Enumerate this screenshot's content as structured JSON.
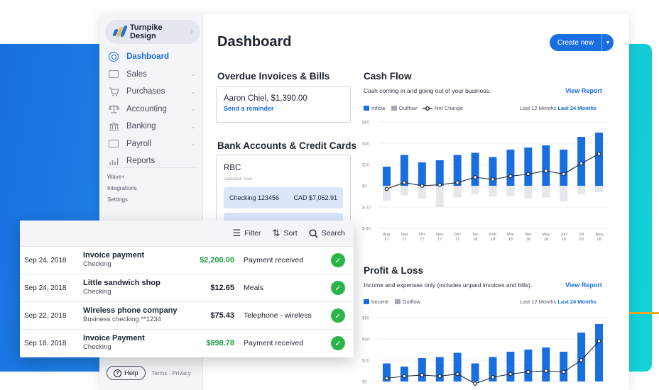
{
  "sidebar": {
    "business_name": "Turnpike Design",
    "nav": [
      {
        "label": "Dashboard",
        "icon": "dashboard-icon",
        "active": true,
        "expandable": false
      },
      {
        "label": "Sales",
        "icon": "sales-icon",
        "active": false,
        "expandable": true
      },
      {
        "label": "Purchases",
        "icon": "cart-icon",
        "active": false,
        "expandable": true
      },
      {
        "label": "Accounting",
        "icon": "scale-icon",
        "active": false,
        "expandable": true
      },
      {
        "label": "Banking",
        "icon": "bank-icon",
        "active": false,
        "expandable": true
      },
      {
        "label": "Payroll",
        "icon": "payroll-icon",
        "active": false,
        "expandable": true
      },
      {
        "label": "Reports",
        "icon": "reports-icon",
        "active": false,
        "expandable": false
      }
    ],
    "links": [
      "Wave+",
      "Integrations",
      "Settings"
    ],
    "help_label": "Help",
    "terms_label": "Terms · Privacy"
  },
  "header": {
    "title": "Dashboard",
    "create_label": "Create new"
  },
  "overdue": {
    "title": "Overdue Invoices & Bills",
    "item": "Aaron Chiel, $1,390.00",
    "reminder": "Send a reminder"
  },
  "bank": {
    "title": "Bank Accounts & Credit Cards",
    "name": "RBC",
    "updated": "Updated: now",
    "account_name": "Checking 123456",
    "account_balance": "CAD $7,062.91"
  },
  "cashflow": {
    "title": "Cash Flow",
    "description": "Cash coming in and going out of your business.",
    "view_report": "View Report",
    "legend": [
      "Inflow",
      "Outflow",
      "Net Change"
    ],
    "range_inactive": "Last 12 Months",
    "range_active": "Last 24 Months"
  },
  "pnl": {
    "title": "Profit & Loss",
    "description": "Income and expenses only (includes unpaid invoices and bills).",
    "view_report": "View Report",
    "legend": [
      "Income",
      "Outflow"
    ],
    "range_inactive": "Last 12 Months",
    "range_active": "Last 24 Months"
  },
  "chart_data": [
    {
      "type": "bar",
      "title": "Cash Flow",
      "y_ticks": [
        "$60",
        "$40",
        "$20",
        "$0",
        "$-20",
        "$-40"
      ],
      "ylim": [
        -40,
        60
      ],
      "categories": [
        [
          "Aug",
          "17"
        ],
        [
          "Sep",
          "17"
        ],
        [
          "Oct",
          "17"
        ],
        [
          "Nov",
          "17"
        ],
        [
          "Dec",
          "17"
        ],
        [
          "Jan",
          "18"
        ],
        [
          "Feb",
          "18"
        ],
        [
          "Mar",
          "18"
        ],
        [
          "Apr",
          "18"
        ],
        [
          "May",
          "18"
        ],
        [
          "Jun",
          "18"
        ],
        [
          "Jul",
          "18"
        ],
        [
          "Aug",
          "18"
        ]
      ],
      "series": [
        {
          "name": "Inflow",
          "color": "#1a6fe0",
          "values": [
            18,
            29,
            22,
            24,
            29,
            31,
            27,
            34,
            36,
            38,
            34,
            46,
            50
          ]
        },
        {
          "name": "Outflow",
          "color": "#e5e7eb",
          "values": [
            -14,
            -9,
            -12,
            -20,
            -11,
            -8,
            -10,
            -10,
            -12,
            -11,
            -15,
            -8,
            -6
          ]
        },
        {
          "name": "Net Change",
          "color": "#1c2330",
          "values": [
            -3,
            3,
            0,
            1,
            3,
            8,
            6,
            9,
            11,
            14,
            11,
            21,
            30
          ]
        }
      ]
    },
    {
      "type": "bar",
      "title": "Profit & Loss",
      "y_ticks": [
        "$60",
        "$40",
        "$20",
        "$0"
      ],
      "ylim": [
        0,
        60
      ],
      "series": [
        {
          "name": "Income",
          "color": "#1a6fe0",
          "values": [
            17,
            14,
            22,
            23,
            27,
            17,
            23,
            28,
            30,
            32,
            28,
            46,
            54
          ]
        },
        {
          "name": "Outflow",
          "color": "#e5e7eb",
          "values": []
        },
        {
          "name": "Net",
          "color": "#1c2330",
          "values": [
            3,
            5,
            6,
            5,
            7,
            -2,
            4,
            7,
            9,
            10,
            9,
            20,
            38
          ]
        }
      ]
    }
  ],
  "transactions": {
    "toolbar": [
      "Filter",
      "Sort",
      "Search"
    ],
    "rows": [
      {
        "date": "Sep 24, 2018",
        "title": "Invoice payment",
        "account": "Checking",
        "amount": "$2,200.00",
        "green": true,
        "category": "Payment received"
      },
      {
        "date": "Sep 24, 2018",
        "title": "Little sandwich shop",
        "account": "Checking",
        "amount": "$12.65",
        "green": false,
        "category": "Meals"
      },
      {
        "date": "Sep 22, 2018",
        "title": "Wireless phone company",
        "account": "Business checking **1234",
        "amount": "$75.43",
        "green": false,
        "category": "Telephone - wireless"
      },
      {
        "date": "Sep 18, 2018",
        "title": "Invoice Payment",
        "account": "Checking",
        "amount": "$898.78",
        "green": true,
        "category": "Payment received"
      }
    ]
  }
}
